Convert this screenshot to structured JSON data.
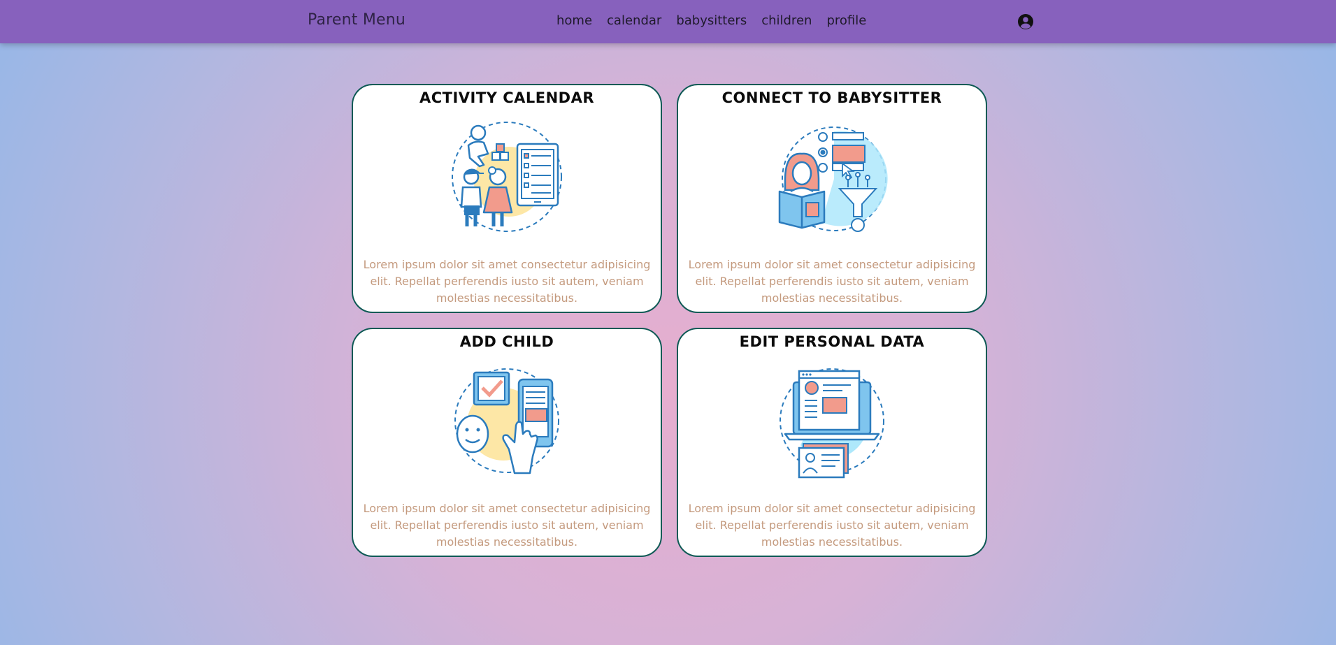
{
  "nav": {
    "brand": "Parent Menu",
    "links": [
      "home",
      "calendar",
      "babysitters",
      "children",
      "profile"
    ],
    "profile_icon": "user-circle-icon"
  },
  "cards": [
    {
      "title": "ACTIVITY CALENDAR",
      "icon": "kids-activity-calendar-illustration",
      "text": "Lorem ipsum dolor sit amet consectetur adipisicing elit. Repellat perferendis iusto sit autem, veniam molestias necessitatibus."
    },
    {
      "title": "CONNECT TO BABYSITTER",
      "icon": "babysitter-selection-illustration",
      "text": "Lorem ipsum dolor sit amet consectetur adipisicing elit. Repellat perferendis iusto sit autem, veniam molestias necessitatibus."
    },
    {
      "title": "ADD CHILD",
      "icon": "add-child-illustration",
      "text": "Lorem ipsum dolor sit amet consectetur adipisicing elit. Repellat perferendis iusto sit autem, veniam molestias necessitatibus."
    },
    {
      "title": "EDIT PERSONAL DATA",
      "icon": "edit-profile-illustration",
      "text": "Lorem ipsum dolor sit amet consectetur adipisicing elit. Repellat perferendis iusto sit autem, veniam molestias necessitatibus."
    }
  ],
  "colors": {
    "navbar": "#8761bd",
    "card_border": "#0e5a55",
    "card_text": "#c49a7e",
    "illustration_blue": "#2b7bbd",
    "illustration_salmon": "#f29b8c",
    "illustration_yellow": "#fde7a6",
    "illustration_lightblue": "#aee8fb"
  }
}
